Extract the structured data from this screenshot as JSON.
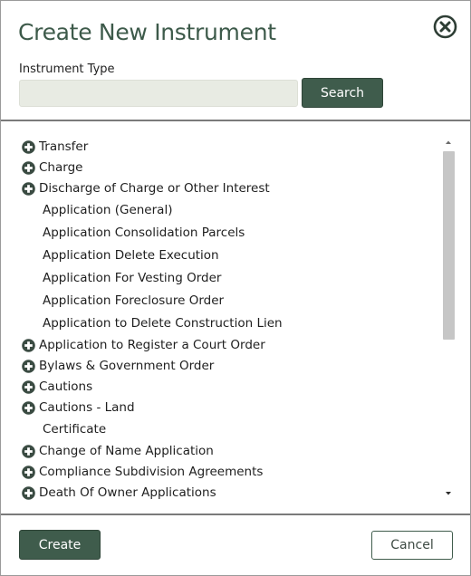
{
  "dialog": {
    "title": "Create New Instrument",
    "close_icon": "close-circle-icon"
  },
  "form": {
    "label": "Instrument Type",
    "input_value": "",
    "input_placeholder": "",
    "search_label": "Search"
  },
  "list": {
    "expand_icon": "plus-circle-icon",
    "items": [
      {
        "label": "Transfer",
        "expandable": true
      },
      {
        "label": "Charge",
        "expandable": true
      },
      {
        "label": "Discharge of Charge or Other Interest",
        "expandable": true
      },
      {
        "label": "Application (General)",
        "expandable": false
      },
      {
        "label": "Application Consolidation Parcels",
        "expandable": false
      },
      {
        "label": "Application Delete Execution",
        "expandable": false
      },
      {
        "label": "Application For Vesting Order",
        "expandable": false
      },
      {
        "label": "Application Foreclosure Order",
        "expandable": false
      },
      {
        "label": "Application to Delete Construction Lien",
        "expandable": false
      },
      {
        "label": "Application to Register a Court Order",
        "expandable": true
      },
      {
        "label": "Bylaws & Government Order",
        "expandable": true
      },
      {
        "label": "Cautions",
        "expandable": true
      },
      {
        "label": "Cautions - Land",
        "expandable": true
      },
      {
        "label": "Certificate",
        "expandable": false
      },
      {
        "label": "Change of Name Application",
        "expandable": true
      },
      {
        "label": "Compliance Subdivision Agreements",
        "expandable": true
      },
      {
        "label": "Death Of Owner Applications",
        "expandable": true
      }
    ]
  },
  "footer": {
    "create_label": "Create",
    "cancel_label": "Cancel"
  },
  "colors": {
    "accent": "#3f5c4c",
    "title": "#3d5a4a",
    "input_bg": "#e8ebe3"
  }
}
